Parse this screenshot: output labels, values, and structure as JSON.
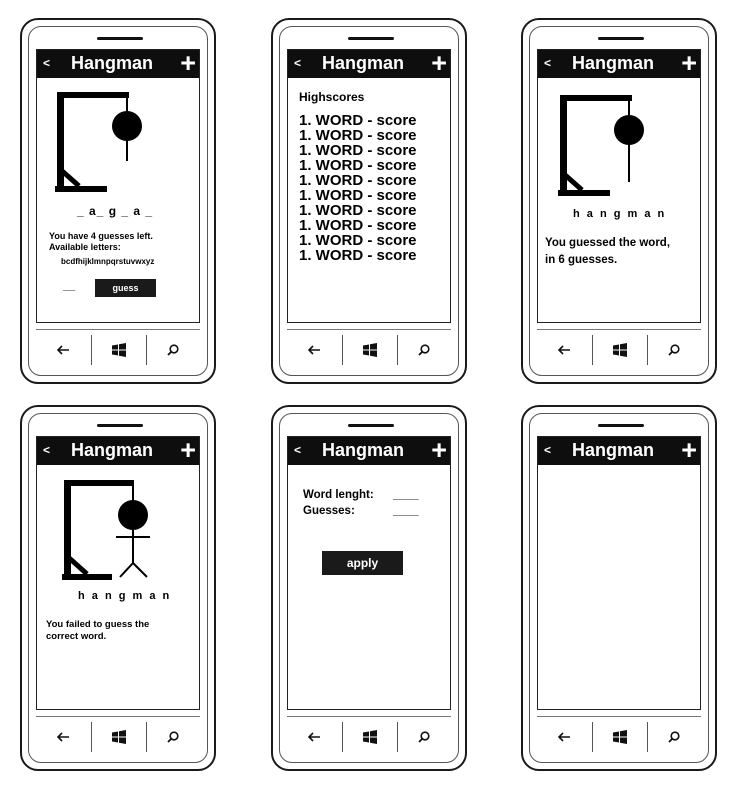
{
  "app": {
    "title": "Hangman",
    "back_label": "<",
    "add_label": "+"
  },
  "screens": {
    "game": {
      "word_pattern": "_ a_ g _ a _",
      "guesses_left": "You have 4 guesses left.",
      "available_label": "Available letters:",
      "letters": "bcdfhijklmnpqrstuvwxyz",
      "input_value": "__",
      "guess_button": "guess"
    },
    "highscores": {
      "heading": "Highscores",
      "entries": [
        "1. WORD - score",
        "1. WORD - score",
        "1. WORD - score",
        "1. WORD - score",
        "1. WORD - score",
        "1. WORD - score",
        "1. WORD - score",
        "1. WORD - score",
        "1. WORD - score",
        "1. WORD - score"
      ]
    },
    "win": {
      "word": "h a n g m a n",
      "message_line1": "You guessed the word,",
      "message_line2": "in 6 guesses."
    },
    "lose": {
      "word": "h a n g m a n",
      "message_line1": "You failed to guess the",
      "message_line2": "correct word."
    },
    "settings": {
      "word_length_label": "Word lenght:",
      "word_length_value": "____",
      "guesses_label": "Guesses:",
      "guesses_value": "____",
      "apply_button": "apply"
    },
    "empty": {}
  },
  "icons": {
    "back": "arrow-left-icon",
    "windows": "windows-logo-icon",
    "search": "search-icon"
  },
  "colors": {
    "title_bar": "#0e0e0e",
    "button": "#1a1a1a"
  }
}
